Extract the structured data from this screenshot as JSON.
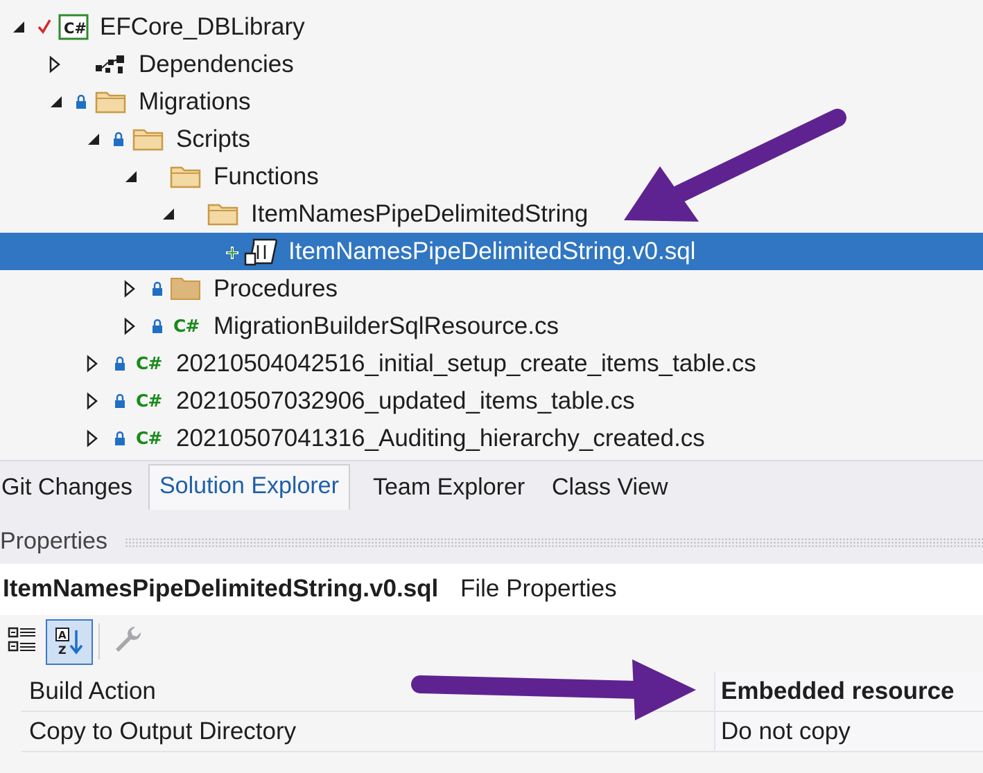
{
  "tree": {
    "project": {
      "label": "EFCore_DBLibrary",
      "badge": "C#"
    },
    "dependencies": {
      "label": "Dependencies"
    },
    "migrations": {
      "label": "Migrations"
    },
    "scripts": {
      "label": "Scripts"
    },
    "functions": {
      "label": "Functions"
    },
    "item_folder": {
      "label": "ItemNamesPipeDelimitedString"
    },
    "sql_file": {
      "label": "ItemNamesPipeDelimitedString.v0.sql"
    },
    "procedures": {
      "label": "Procedures"
    },
    "builder": {
      "label": "MigrationBuilderSqlResource.cs",
      "badge": "C#"
    },
    "migration_files": [
      {
        "label": "20210504042516_initial_setup_create_items_table.cs",
        "badge": "C#"
      },
      {
        "label": "20210507032906_updated_items_table.cs",
        "badge": "C#"
      },
      {
        "label": "20210507041316_Auditing_hierarchy_created.cs",
        "badge": "C#"
      }
    ]
  },
  "tabs": [
    {
      "label": "Git Changes"
    },
    {
      "label": "Solution Explorer"
    },
    {
      "label": "Team Explorer"
    },
    {
      "label": "Class View"
    }
  ],
  "properties": {
    "title": "Properties",
    "file_name": "ItemNamesPipeDelimitedString.v0.sql",
    "file_type": "File Properties",
    "rows": [
      {
        "name": "Build Action",
        "value": "Embedded resource"
      },
      {
        "name": "Copy to Output Directory",
        "value": "Do not copy"
      }
    ]
  },
  "colors": {
    "selection": "#3076c2",
    "annotation_arrow": "#5e2390",
    "csharp_green": "#1a8a1a",
    "folder": "#dcb67a",
    "lock_blue": "#1f6fc5"
  }
}
